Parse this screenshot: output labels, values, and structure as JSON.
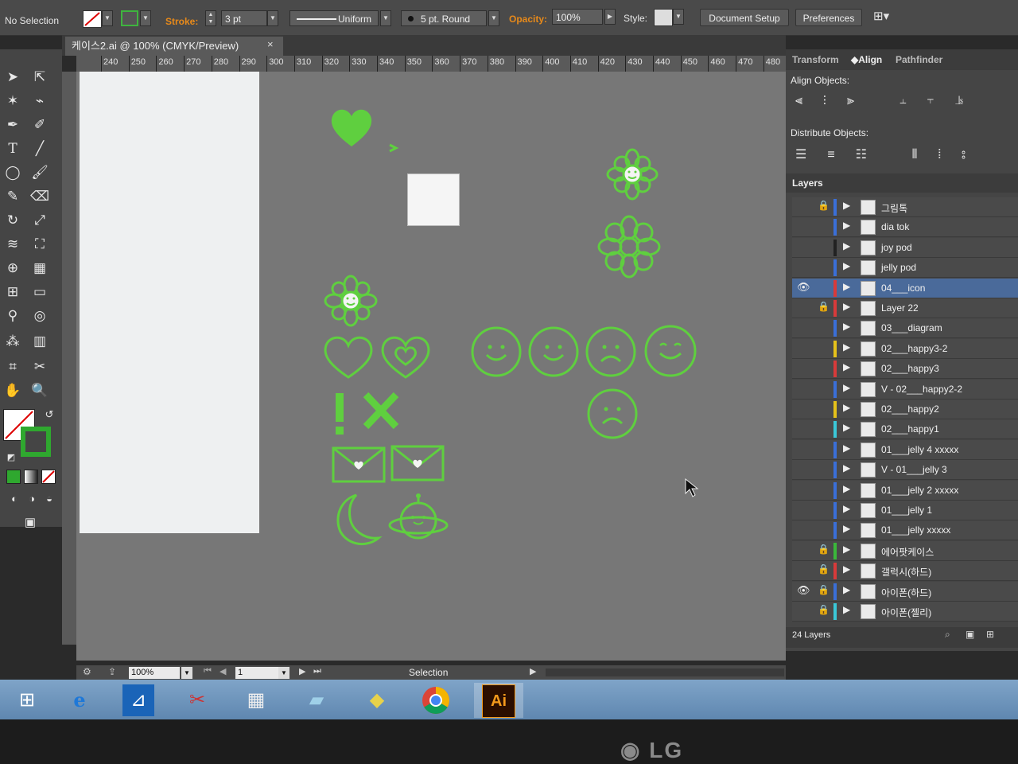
{
  "control_bar": {
    "selection_status": "No Selection",
    "stroke_label": "Stroke:",
    "stroke_weight": "3 pt",
    "profile": "Uniform",
    "brush": "5 pt. Round",
    "opacity_label": "Opacity:",
    "opacity_value": "100%",
    "style_label": "Style:",
    "document_setup": "Document Setup",
    "preferences": "Preferences"
  },
  "document": {
    "tab_title": "케이스2.ai @ 100% (CMYK/Preview)",
    "close_glyph": "×"
  },
  "ruler": {
    "top_ticks": [
      "240",
      "250",
      "260",
      "270",
      "280",
      "290",
      "300",
      "310",
      "320",
      "330",
      "340",
      "350",
      "360",
      "370",
      "380",
      "390",
      "400",
      "410",
      "420",
      "430",
      "440",
      "450",
      "460",
      "470",
      "480"
    ]
  },
  "status_bar": {
    "zoom": "100%",
    "artboard_number": "1",
    "tool_status": "Selection"
  },
  "panel": {
    "tabs": [
      "Transform",
      "Align",
      "Pathfinder"
    ],
    "align_objects_label": "Align Objects:",
    "distribute_objects_label": "Distribute Objects:",
    "layers_tab": "Layers",
    "layers_count": "24 Layers",
    "layers": [
      {
        "name": "그림톡",
        "color": "#3a6fd8",
        "locked": true,
        "visible": false
      },
      {
        "name": "dia tok",
        "color": "#3a6fd8",
        "locked": false,
        "visible": false
      },
      {
        "name": "joy pod",
        "color": "#222222",
        "locked": false,
        "visible": false
      },
      {
        "name": "jelly pod",
        "color": "#3a6fd8",
        "locked": false,
        "visible": false
      },
      {
        "name": "04___icon",
        "color": "#d83a3a",
        "locked": false,
        "visible": true,
        "selected": true
      },
      {
        "name": "Layer 22",
        "color": "#d83a3a",
        "locked": true,
        "visible": false
      },
      {
        "name": "03___diagram",
        "color": "#3a6fd8",
        "locked": false,
        "visible": false
      },
      {
        "name": "02___happy3-2",
        "color": "#e6c21a",
        "locked": false,
        "visible": false
      },
      {
        "name": "02___happy3",
        "color": "#d83a3a",
        "locked": false,
        "visible": false
      },
      {
        "name": "V - 02___happy2-2",
        "color": "#3a6fd8",
        "locked": false,
        "visible": false
      },
      {
        "name": "02___happy2",
        "color": "#e6c21a",
        "locked": false,
        "visible": false
      },
      {
        "name": "02___happy1",
        "color": "#3ac8d8",
        "locked": false,
        "visible": false
      },
      {
        "name": "01___jelly 4 xxxxx",
        "color": "#3a6fd8",
        "locked": false,
        "visible": false
      },
      {
        "name": "V - 01___jelly 3",
        "color": "#3a6fd8",
        "locked": false,
        "visible": false
      },
      {
        "name": "01___jelly 2 xxxxx",
        "color": "#3a6fd8",
        "locked": false,
        "visible": false
      },
      {
        "name": "01___jelly 1",
        "color": "#3a6fd8",
        "locked": false,
        "visible": false
      },
      {
        "name": "01___jelly xxxxx",
        "color": "#3a6fd8",
        "locked": false,
        "visible": false
      },
      {
        "name": "에어팟케이스",
        "color": "#3ab83a",
        "locked": true,
        "visible": false
      },
      {
        "name": "갤럭시(하드)",
        "color": "#d83a3a",
        "locked": true,
        "visible": false
      },
      {
        "name": "아이폰(하드)",
        "color": "#3a6fd8",
        "locked": true,
        "visible": true
      },
      {
        "name": "아이폰(젤리)",
        "color": "#3ac8d8",
        "locked": true,
        "visible": false
      }
    ]
  },
  "taskbar": {
    "apps": [
      "windows-start",
      "internet-explorer",
      "scan-app",
      "snipping-tool",
      "calculator",
      "file-app",
      "sticky-notes",
      "chrome",
      "illustrator"
    ],
    "illustrator_label": "Ai"
  },
  "monitor": {
    "brand": "LG"
  },
  "colors": {
    "icon_green": "#5fcf3f",
    "canvas_gray": "#777777",
    "selected_layer": "#4a6a9a"
  }
}
